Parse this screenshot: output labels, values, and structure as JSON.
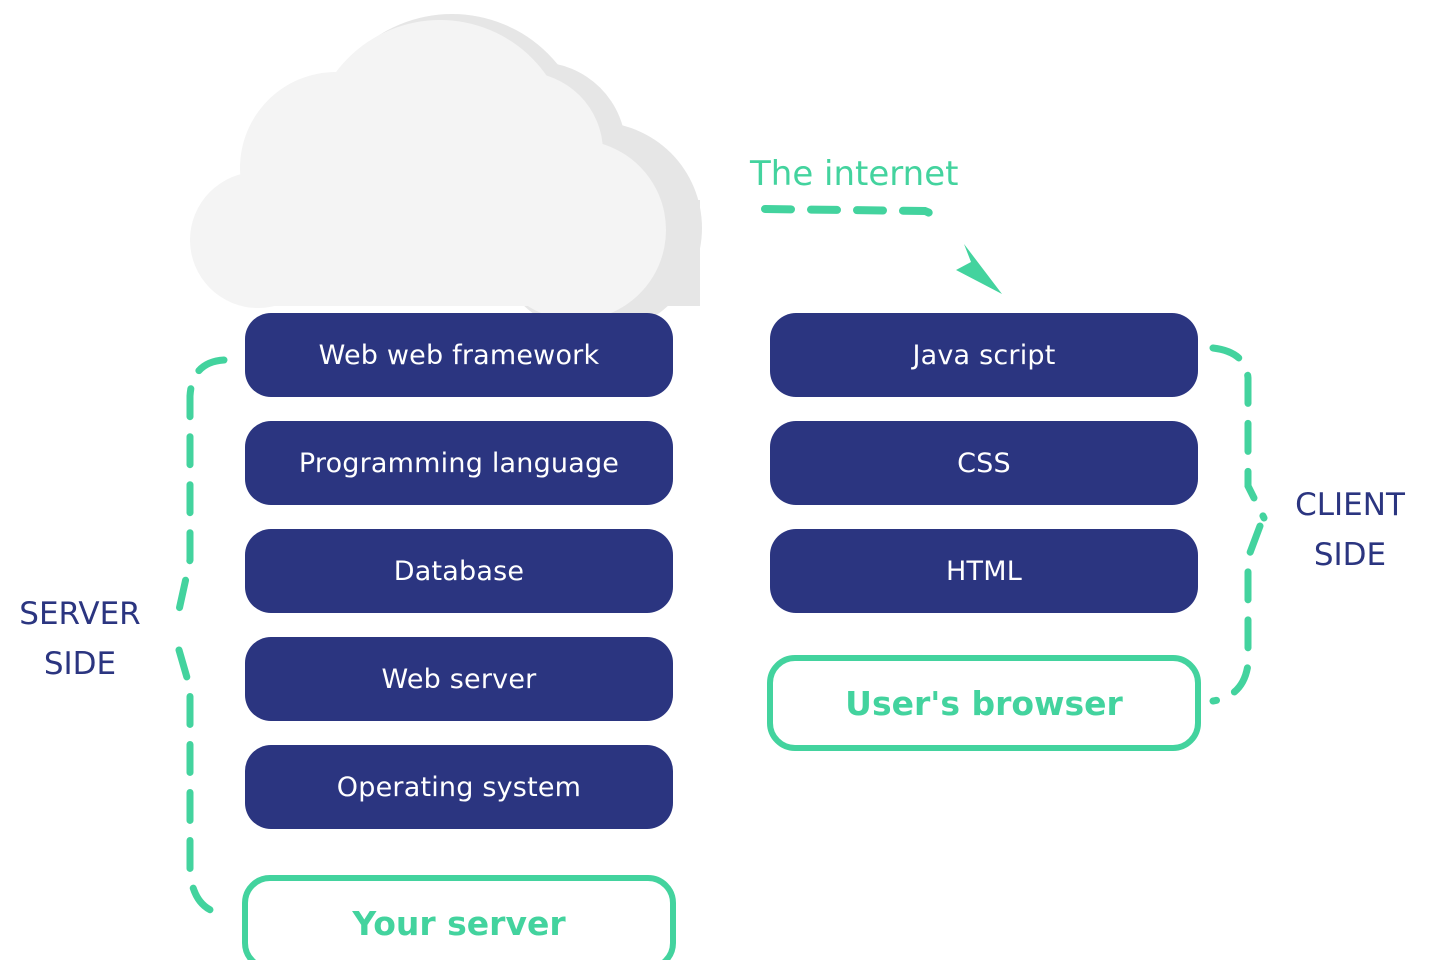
{
  "internet_label": "The internet",
  "server": {
    "layers": [
      "Web web framework",
      "Programming language",
      "Database",
      "Web server",
      "Operating system"
    ],
    "base_label": "Your server",
    "side_label_line1": "SERVER",
    "side_label_line2": "SIDE"
  },
  "client": {
    "layers": [
      "Java script",
      "CSS",
      "HTML"
    ],
    "base_label": "User's browser",
    "side_label_line1": "CLIENT",
    "side_label_line2": "SIDE"
  },
  "colors": {
    "layer_fill": "#2b3580",
    "accent_green": "#43d39e",
    "cloud_light": "#f4f4f4",
    "cloud_shadow": "#e6e6e6",
    "text_navy": "#2b3580"
  },
  "icons": [
    "cloud-icon",
    "arrow-icon"
  ]
}
